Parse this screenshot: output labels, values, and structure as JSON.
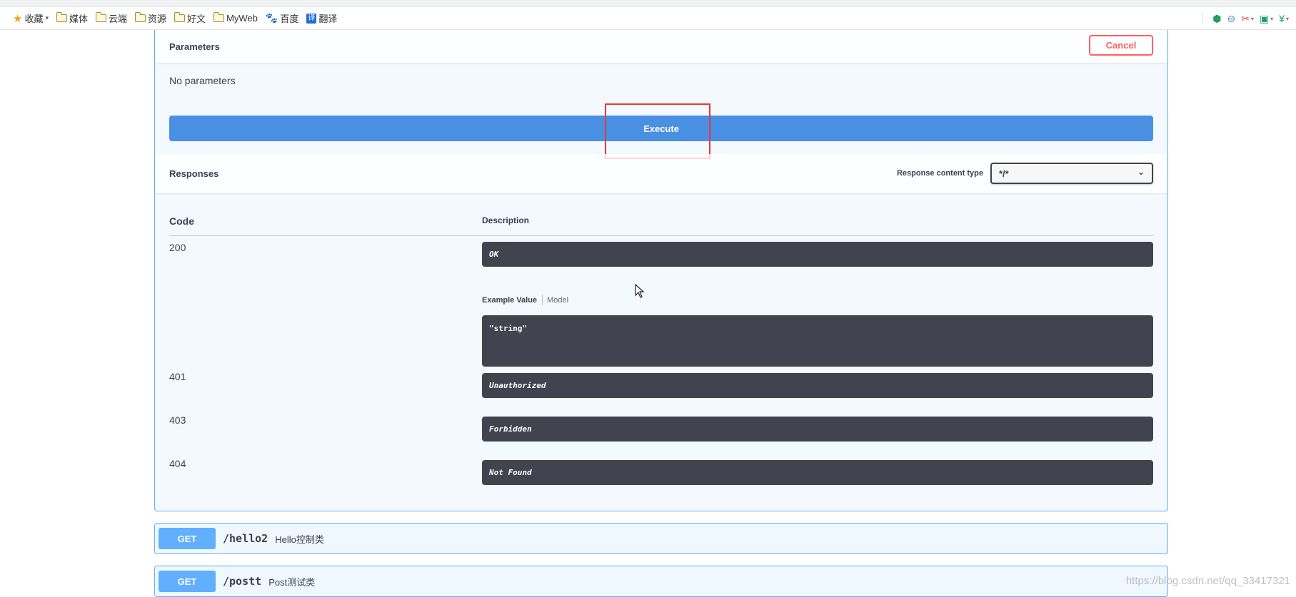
{
  "browser": {
    "bookmarks": [
      {
        "icon": "star-icon",
        "label": "收藏",
        "has_dropdown": true
      },
      {
        "icon": "folder-icon",
        "label": "媒体"
      },
      {
        "icon": "folder-icon",
        "label": "云端"
      },
      {
        "icon": "folder-icon",
        "label": "资源"
      },
      {
        "icon": "folder-icon",
        "label": "好文"
      },
      {
        "icon": "folder-icon",
        "label": "MyWeb"
      },
      {
        "icon": "baidu-paw-icon",
        "label": "百度"
      },
      {
        "icon": "translate-icon",
        "label": "翻译"
      }
    ],
    "translate_glyph": "译",
    "toolbar_icons": [
      "shield-icon",
      "minus-circle-icon",
      "scissors-icon",
      "picture-icon",
      "yen-icon"
    ]
  },
  "parameters": {
    "title": "Parameters",
    "cancel_label": "Cancel",
    "empty_text": "No parameters"
  },
  "execute_label": "Execute",
  "responses": {
    "title": "Responses",
    "content_type_label": "Response content type",
    "content_type_value": "*/*",
    "col_code": "Code",
    "col_description": "Description",
    "rows": [
      {
        "code": "200",
        "description": "OK"
      },
      {
        "code": "401",
        "description": "Unauthorized"
      },
      {
        "code": "403",
        "description": "Forbidden"
      },
      {
        "code": "404",
        "description": "Not Found"
      }
    ],
    "example_tab_active": "Example Value",
    "example_tab_model": "Model",
    "example_value": "\"string\""
  },
  "operations": [
    {
      "method": "GET",
      "path": "/hello2",
      "summary": "Hello控制类"
    },
    {
      "method": "GET",
      "path": "/postt",
      "summary": "Post测试类"
    }
  ],
  "watermark": "https://blog.csdn.net/qq_33417321",
  "colors": {
    "get_blue": "#61affe",
    "execute_blue": "#4990e2",
    "cancel_red": "#ff6060",
    "dark_block": "#41444e",
    "highlight_red": "#e53935"
  }
}
